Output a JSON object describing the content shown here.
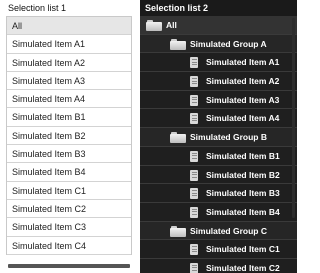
{
  "left": {
    "title": "Selection list 1",
    "items": [
      "All",
      "Simulated Item A1",
      "Simulated Item A2",
      "Simulated Item A3",
      "Simulated Item A4",
      "Simulated Item B1",
      "Simulated Item B2",
      "Simulated Item B3",
      "Simulated Item B4",
      "Simulated Item C1",
      "Simulated Item C2",
      "Simulated Item C3",
      "Simulated Item C4"
    ],
    "selected_index": 0
  },
  "right": {
    "title": "Selection list 2",
    "tree": [
      {
        "label": "All",
        "kind": "root",
        "icon": "folder-icon"
      },
      {
        "label": "Simulated Group A",
        "kind": "group",
        "icon": "folder-icon"
      },
      {
        "label": "Simulated Item A1",
        "kind": "item",
        "icon": "document-icon"
      },
      {
        "label": "Simulated Item A2",
        "kind": "item",
        "icon": "document-icon"
      },
      {
        "label": "Simulated Item A3",
        "kind": "item",
        "icon": "document-icon"
      },
      {
        "label": "Simulated Item A4",
        "kind": "item",
        "icon": "document-icon"
      },
      {
        "label": "Simulated Group B",
        "kind": "group",
        "icon": "folder-icon"
      },
      {
        "label": "Simulated Item B1",
        "kind": "item",
        "icon": "document-icon"
      },
      {
        "label": "Simulated Item B2",
        "kind": "item",
        "icon": "document-icon"
      },
      {
        "label": "Simulated Item B3",
        "kind": "item",
        "icon": "document-icon"
      },
      {
        "label": "Simulated Item B4",
        "kind": "item",
        "icon": "document-icon"
      },
      {
        "label": "Simulated Group C",
        "kind": "group",
        "icon": "folder-icon"
      },
      {
        "label": "Simulated Item C1",
        "kind": "item",
        "icon": "document-icon"
      },
      {
        "label": "Simulated Item C2",
        "kind": "item",
        "icon": "document-icon"
      }
    ]
  },
  "colors": {
    "left_background": "#ffffff",
    "left_selected": "#e6e6e6",
    "right_background": "#1e1e1e",
    "right_text": "#ffffff"
  }
}
